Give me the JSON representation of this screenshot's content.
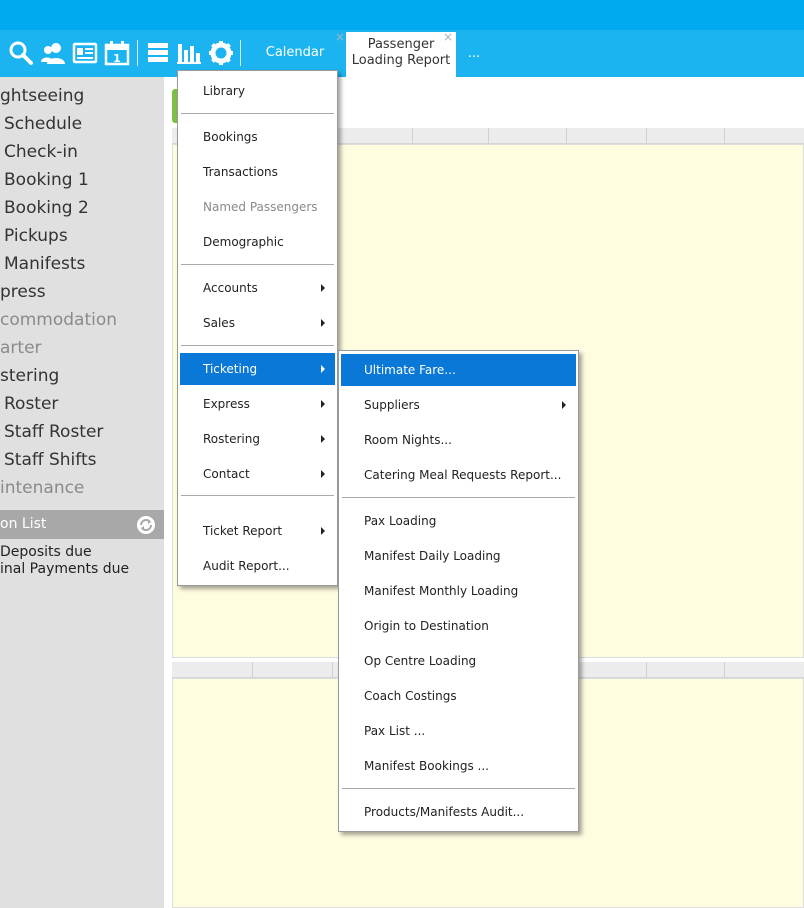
{
  "toolbar": {
    "icons": [
      "search-icon",
      "contacts-icon",
      "id-card-icon",
      "calendar-icon",
      "server-icon",
      "bar-chart-icon",
      "gear-icon"
    ],
    "tabs": [
      {
        "label": "Calendar",
        "closable": true,
        "active": false
      },
      {
        "label_line1": "Passenger",
        "label_line2": "Loading Report",
        "closable": true,
        "active": true
      },
      {
        "label": "..."
      }
    ],
    "close_glyph": "×"
  },
  "sidebar": {
    "items": [
      {
        "label": "ghtseeing",
        "dim": false
      },
      {
        "label": "Schedule",
        "dim": false
      },
      {
        "label": "Check-in",
        "dim": false
      },
      {
        "label": "Booking 1",
        "dim": false
      },
      {
        "label": "Booking 2",
        "dim": false
      },
      {
        "label": "Pickups",
        "dim": false
      },
      {
        "label": "Manifests",
        "dim": false
      },
      {
        "label": "press",
        "dim": false
      },
      {
        "label": "commodation",
        "dim": true
      },
      {
        "label": "arter",
        "dim": true
      },
      {
        "label": "stering",
        "dim": false
      },
      {
        "label": "Roster",
        "dim": false
      },
      {
        "label": "Staff Roster",
        "dim": false
      },
      {
        "label": "Staff Shifts",
        "dim": false
      },
      {
        "label": "intenance",
        "dim": true
      }
    ],
    "section_label": "on List",
    "notes": [
      "Deposits due",
      "inal Payments due"
    ]
  },
  "main_menu": {
    "items": [
      {
        "label": "Library"
      },
      {
        "sep": true
      },
      {
        "label": "Bookings"
      },
      {
        "label": "Transactions"
      },
      {
        "label": "Named Passengers",
        "disabled": true
      },
      {
        "label": "Demographic"
      },
      {
        "sep": true
      },
      {
        "label": "Accounts",
        "submenu": true
      },
      {
        "label": "Sales",
        "submenu": true
      },
      {
        "sep": true
      },
      {
        "label": "Ticketing",
        "submenu": true,
        "active": true
      },
      {
        "label": "Express",
        "submenu": true
      },
      {
        "label": "Rostering",
        "submenu": true
      },
      {
        "label": "Contact",
        "submenu": true
      },
      {
        "sep": true
      },
      {
        "label": "Ticket Report",
        "submenu": true
      },
      {
        "label": "Audit Report..."
      }
    ]
  },
  "ticketing_menu": {
    "items": [
      {
        "label": "Ultimate Fare...",
        "active": true
      },
      {
        "label": "Suppliers",
        "submenu": true
      },
      {
        "label": "Room Nights..."
      },
      {
        "label": "Catering Meal Requests Report..."
      },
      {
        "sep": true
      },
      {
        "label": "Pax Loading"
      },
      {
        "label": "Manifest Daily Loading"
      },
      {
        "label": "Manifest Monthly Loading"
      },
      {
        "label": "Origin to Destination"
      },
      {
        "label": "Op Centre Loading"
      },
      {
        "label": "Coach Costings"
      },
      {
        "label": "Pax List ..."
      },
      {
        "label": "Manifest Bookings ..."
      },
      {
        "sep": true
      },
      {
        "label": "Products/Manifests Audit..."
      }
    ]
  }
}
